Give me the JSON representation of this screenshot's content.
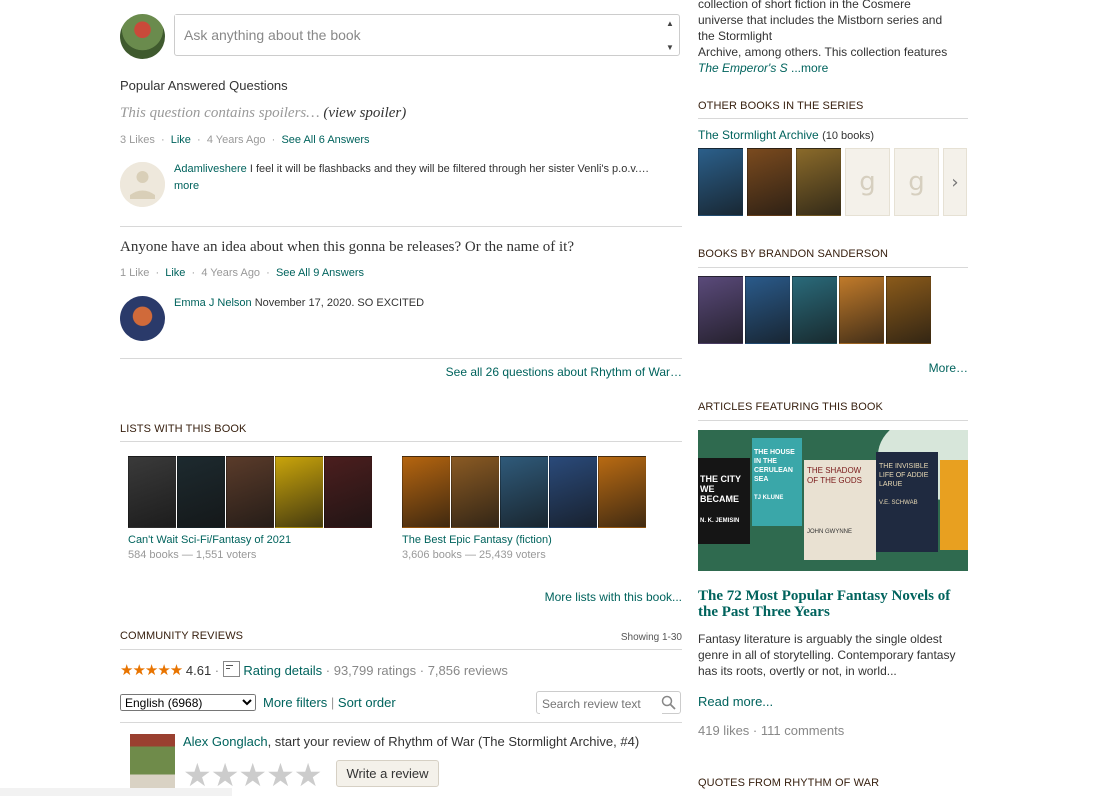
{
  "ask": {
    "placeholder": "Ask anything about the book"
  },
  "popular_questions": {
    "heading": "Popular Answered Questions",
    "q1": {
      "text": "This question contains spoilers…",
      "spoiler_link": "(view spoiler)",
      "likes": "3 Likes",
      "like": "Like",
      "age": "4 Years Ago",
      "see_all": "See All 6 Answers",
      "answer_user": "Adamliveshere",
      "answer_text": "I feel it will be flashbacks and they will be filtered through her sister Venli's p.o.v.…",
      "more": "more"
    },
    "q2": {
      "text": "Anyone have an idea about when this gonna be releases? Or the name of it?",
      "likes": "1 Like",
      "like": "Like",
      "age": "4 Years Ago",
      "see_all": "See All 9 Answers",
      "answer_user": "Emma J Nelson",
      "answer_text": "November 17, 2020. SO EXCITED"
    },
    "see_all_questions": "See all 26 questions about Rhythm of War…"
  },
  "lists": {
    "heading": "LISTS WITH THIS BOOK",
    "items": [
      {
        "title": "Can't Wait Sci-Fi/Fantasy of 2021",
        "meta": "584 books — 1,551 voters",
        "covers": [
          "#3a3a3a",
          "#1d2a2f",
          "#5a3b2a",
          "#c9a40b",
          "#4b1e1e"
        ]
      },
      {
        "title": "The Best Epic Fantasy (fiction)",
        "meta": "3,606 books — 25,439 voters",
        "covers": [
          "#b5650f",
          "#8a5a23",
          "#2f5a7a",
          "#2a4a7a",
          "#b86a12"
        ]
      }
    ],
    "more_link": "More lists with this book..."
  },
  "community_reviews": {
    "heading": "COMMUNITY REVIEWS",
    "showing": "Showing 1-30",
    "stars": "★★★★★",
    "avg": "4.61",
    "rating_details": "Rating details",
    "ratings": "93,799 ratings",
    "reviews": "7,856 reviews",
    "language_selected": "English (6968)",
    "more_filters": "More filters",
    "sort_order": "Sort order",
    "search_placeholder": "Search review text",
    "user_name": "Alex Gonglach",
    "start_review_text": ", start your review of Rhythm of War (The Stormlight Archive, #4)",
    "empty_stars": "★★★★★",
    "write_review": "Write a review"
  },
  "right": {
    "blurb_line1": "collection of short fiction in the Cosmere",
    "blurb_line2": "universe that includes the Mistborn series and",
    "blurb_line3": "the Stormlight",
    "blurb_line4": "Archive, among others. This collection features",
    "blurb_line5": "The Emperor's S",
    "blurb_more": " ...more",
    "series_heading": "OTHER BOOKS IN THE SERIES",
    "series_name": "The Stormlight Archive",
    "series_count": "(10 books)",
    "series_covers": [
      "#2b5f8a",
      "#7a4a1e",
      "#8a6a2a"
    ],
    "author_heading": "BOOKS BY BRANDON SANDERSON",
    "author_covers": [
      "#5a4a7a",
      "#2a5a8a",
      "#2a6a7a",
      "#c07a2a",
      "#8a5a1a"
    ],
    "author_more": "More…",
    "articles_heading": "ARTICLES FEATURING THIS BOOK",
    "article_title": "The 72 Most Popular Fantasy Novels of the Past Three Years",
    "article_body": "Fantasy literature is arguably the single oldest genre in all of storytelling. Contemporary fantasy has its roots, overtly or not, in world...",
    "read_more": "Read more...",
    "article_stats": "419 likes · 111 comments",
    "quotes_heading": "QUOTES FROM RHYTHM OF WAR",
    "article_image_books": [
      "THE CITY WE BECAME",
      "THE HOUSE IN THE CERULEAN SEA",
      "THE SHADOW OF THE GODS",
      "THE INVISIBLE LIFE OF ADDIE LARUE"
    ],
    "article_image_authors": [
      "N. K. JEMISIN",
      "TJ KLUNE",
      "JOHN GWYNNE",
      "V.E. SCHWAB"
    ]
  }
}
